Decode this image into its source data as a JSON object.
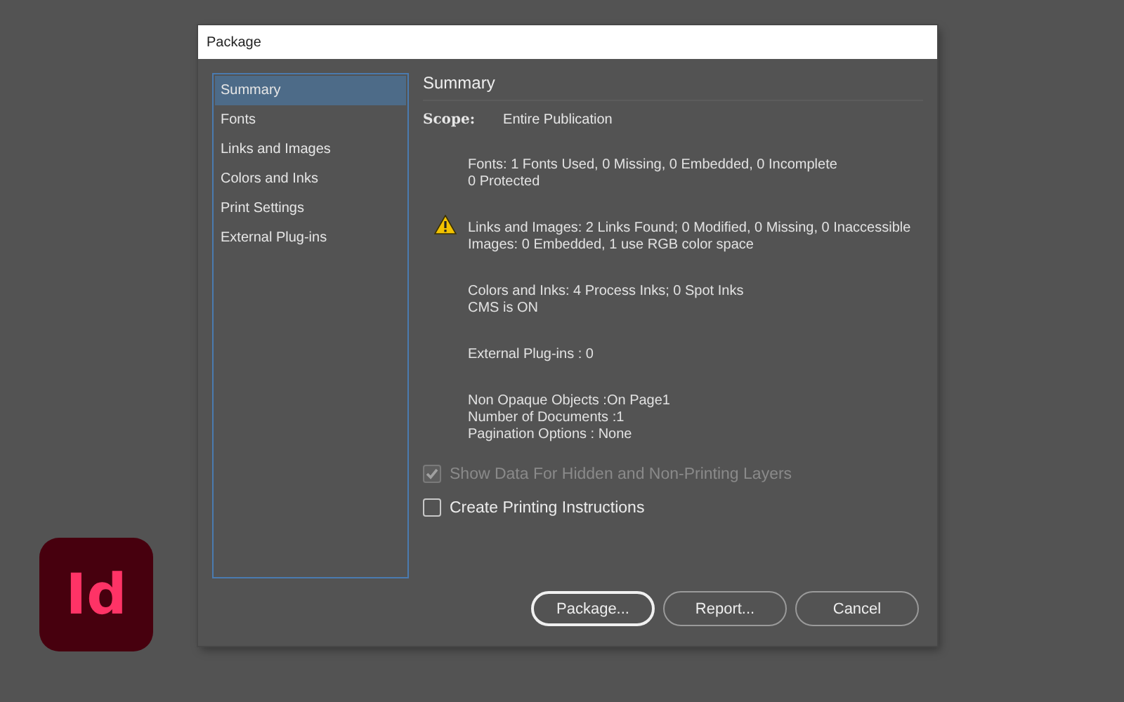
{
  "window": {
    "title": "Package"
  },
  "sidebar": {
    "items": [
      {
        "label": "Summary",
        "selected": true
      },
      {
        "label": "Fonts",
        "selected": false
      },
      {
        "label": "Links and Images",
        "selected": false
      },
      {
        "label": "Colors and Inks",
        "selected": false
      },
      {
        "label": "Print Settings",
        "selected": false
      },
      {
        "label": "External Plug-ins",
        "selected": false
      }
    ]
  },
  "summary": {
    "heading": "Summary",
    "scope_label": "Scope:",
    "scope_value": "Entire Publication",
    "sections": [
      {
        "warning": false,
        "lines": [
          "Fonts: 1 Fonts Used, 0 Missing, 0 Embedded, 0 Incomplete",
          "0 Protected"
        ]
      },
      {
        "warning": true,
        "lines": [
          "Links and Images: 2 Links Found; 0 Modified, 0 Missing, 0 Inaccessible",
          "Images: 0 Embedded, 1 use RGB color space"
        ]
      },
      {
        "warning": false,
        "lines": [
          "Colors and Inks: 4 Process Inks; 0 Spot Inks",
          "CMS is ON"
        ]
      },
      {
        "warning": false,
        "lines": [
          "External Plug-ins : 0"
        ]
      },
      {
        "warning": false,
        "lines": [
          "Non Opaque Objects :On Page1",
          "Number of Documents :1",
          "Pagination Options : None"
        ]
      }
    ]
  },
  "options": [
    {
      "label": "Show Data For Hidden and Non-Printing Layers",
      "checked": true,
      "disabled": true
    },
    {
      "label": "Create Printing Instructions",
      "checked": false,
      "disabled": false
    }
  ],
  "buttons": [
    {
      "label": "Package...",
      "default": true
    },
    {
      "label": "Report...",
      "default": false
    },
    {
      "label": "Cancel",
      "default": false
    }
  ],
  "app_icon": {
    "text": "Id"
  }
}
